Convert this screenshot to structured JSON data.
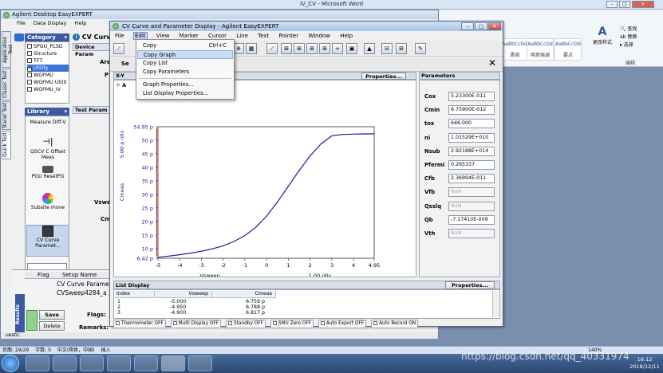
{
  "word": {
    "title": "IV_CV  -  Microsoft Word",
    "ribbon_styles": [
      {
        "sample": "AaBbCcDd",
        "label": "清调"
      },
      {
        "sample": "AaBbCcDd",
        "label": "明显强调"
      },
      {
        "sample": "AaBbCcDd",
        "label": "要点"
      }
    ],
    "change_styles": "更改样式",
    "edit_items": [
      "查找",
      "替换",
      "选择"
    ],
    "edit_group": "编辑",
    "status_items": [
      "页面: 29/29",
      "字数: 0",
      "中文(简体，中国)",
      "插入"
    ],
    "zoom": "140%",
    "time": "18:12",
    "date": "2018/12/11"
  },
  "watermark": "https://blog.csdn.net/qq_40331974",
  "easyexpert": {
    "title": "Agilent Desktop EasyEXPERT",
    "menu": [
      "File",
      "Data Display",
      "Help"
    ],
    "vertical_tabs": [
      "Application Test",
      "Classic Test",
      "Tracer Test",
      "Quick Test"
    ],
    "category_title": "Category",
    "categories": [
      {
        "label": "SPGU_PLSD",
        "checked": false
      },
      {
        "label": "Structure",
        "checked": false
      },
      {
        "label": "TFT",
        "checked": false
      },
      {
        "label": "Utility",
        "checked": true,
        "selected": true
      },
      {
        "label": "WGFMU",
        "checked": false
      },
      {
        "label": "WGFMU Utilit",
        "checked": false
      },
      {
        "label": "WGFMU_IV",
        "checked": false
      }
    ],
    "library_title": "Library",
    "library_items": [
      {
        "label": "Measure Diff-V"
      },
      {
        "label": "QSCV C Offset Meas"
      },
      {
        "label": "PGU ResetPG"
      },
      {
        "label": "Subsite move"
      },
      {
        "label": "CV Curve Paramet...",
        "selected": true
      }
    ],
    "cv_title_fragment": "CV Curv",
    "device_params_fragment": "Device Param",
    "test_params_fragment": "Test Param",
    "side_labels": [
      "Are",
      "P",
      "Vsweep",
      "Cmea"
    ],
    "results_label": "Results",
    "results_table": {
      "flag_col": "Flag",
      "setup_col": "Setup Name",
      "rows": [
        "CV Curve Paramet",
        "CVSweep4284_a"
      ]
    },
    "save_label": "Save",
    "delete_label": "Delete",
    "flags_label": "Flags:",
    "remarks_label": "Remarks:",
    "status_fragment": "uests:"
  },
  "dialog": {
    "title": "CV Curve and Parameter Display - Agilent EasyEXPERT",
    "menu": [
      "File",
      "Edit",
      "View",
      "Marker",
      "Cursor",
      "Line",
      "Text",
      "Pointer",
      "Window",
      "Help"
    ],
    "active_menu": "Edit",
    "edit_dropdown": [
      {
        "label": "Copy",
        "shortcut": "Ctrl+C"
      },
      {
        "label": "Copy Graph",
        "shortcut": "",
        "highlighted": true
      },
      {
        "label": "Copy List",
        "shortcut": ""
      },
      {
        "label": "Copy Parameters",
        "shortcut": ""
      },
      {
        "separator": true
      },
      {
        "label": "Graph Properties...",
        "shortcut": ""
      },
      {
        "label": "List Display Properties...",
        "shortcut": ""
      }
    ],
    "graph_header": "X-Y",
    "graph_header_tab": "A",
    "properties_label": "Properties...",
    "parameters_title": "Parameters",
    "parameters": [
      {
        "name": "Cox",
        "value": "5.23300E-011",
        "disabled": false
      },
      {
        "name": "Cmin",
        "value": "6.75900E-012",
        "disabled": false
      },
      {
        "name": "tox",
        "value": "646.000",
        "disabled": false
      },
      {
        "name": "ni",
        "value": "1.01529E+010",
        "disabled": false
      },
      {
        "name": "Nsub",
        "value": "2.92188E+014",
        "disabled": false
      },
      {
        "name": "Pfermi",
        "value": "0.265337",
        "disabled": false
      },
      {
        "name": "Cfb",
        "value": "2.36994E-011",
        "disabled": false
      },
      {
        "name": "Vfb",
        "value": "NaN",
        "disabled": true
      },
      {
        "name": "Qsslq",
        "value": "NaN",
        "disabled": true
      },
      {
        "name": "Qb",
        "value": "-7.17410E-009",
        "disabled": false
      },
      {
        "name": "Vth",
        "value": "NaN",
        "disabled": true
      }
    ],
    "list_title": "List Display",
    "list_properties_label": "Properties...",
    "list_columns": [
      "Index",
      "Vsweep",
      "Cmeas"
    ],
    "list_rows": [
      [
        "1",
        "-5.000",
        "6.759 p"
      ],
      [
        "2",
        "-4.950",
        "6.788 p"
      ],
      [
        "3",
        "-4.900",
        "6.817 p"
      ]
    ],
    "status_toggles": [
      "Thermometer OFF",
      "Multi Display OFF",
      "Standby OFF",
      "SMU Zero OFF",
      "Auto Export OFF",
      "Auto Record ON"
    ]
  },
  "chart_data": {
    "type": "line",
    "title": "",
    "xlabel": "Vsweep",
    "ylabel": "Cmeas",
    "x_scale_label": "1.00 /div",
    "y_scale_label": "5.00 p /div",
    "xlim": [
      -5,
      4.95
    ],
    "ylim": [
      6.42,
      54.95
    ],
    "x_ticks": [
      "-5",
      "-4",
      "-3",
      "-2",
      "-1",
      "0",
      "1",
      "2",
      "3",
      "4",
      "4.95"
    ],
    "y_ticks": [
      "54.95 p",
      "50 p",
      "45 p",
      "40 p",
      "35 p",
      "30 p",
      "25 p",
      "20 p",
      "15 p",
      "10 p",
      "6.42 p"
    ],
    "series": [
      {
        "name": "Cmeas",
        "color": "#1a1aa0",
        "x": [
          -5,
          -4.5,
          -4,
          -3.5,
          -3,
          -2.5,
          -2,
          -1.5,
          -1,
          -0.5,
          0,
          0.5,
          1,
          1.5,
          2,
          2.5,
          3,
          3.5,
          4,
          4.5,
          4.95
        ],
        "y": [
          6.76,
          7.2,
          7.7,
          8.3,
          9.0,
          9.9,
          11.0,
          12.6,
          14.8,
          17.8,
          22.0,
          27.2,
          33.0,
          38.8,
          44.2,
          48.6,
          51.6,
          52.1,
          52.2,
          52.3,
          52.3
        ]
      }
    ],
    "marker_line": {
      "x": -5,
      "color": "#e02020"
    },
    "grid": false
  }
}
